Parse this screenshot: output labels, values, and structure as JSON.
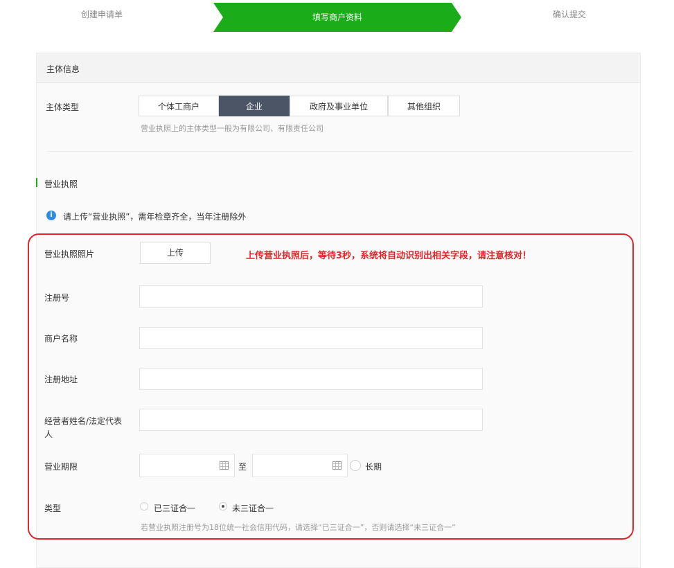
{
  "steps": [
    "创建申请单",
    "填写商户资料",
    "确认提交"
  ],
  "colors": {
    "accent_green": "#1aad19",
    "active_segment": "#4c5566",
    "alert_red": "#e0262b",
    "info_blue": "#2f8be6"
  },
  "panel": {
    "title": "主体信息"
  },
  "entity": {
    "label": "主体类型",
    "options": [
      "个体工商户",
      "企业",
      "政府及事业单位",
      "其他组织"
    ],
    "selected": "企业",
    "hint": "营业执照上的主体类型一般为有限公司、有限责任公司"
  },
  "license": {
    "section_title": "营业执照",
    "info_icon": "info-icon",
    "notice": "请上传“营业执照”，需年检章齐全，当年注册除外",
    "photo_label": "营业执照照片",
    "upload_label": "上传",
    "red_note": "上传营业执照后，等待3秒，系统将自动识别出相关字段，请注意核对！",
    "fields": [
      {
        "label": "注册号",
        "value": ""
      },
      {
        "label": "商户名称",
        "value": ""
      },
      {
        "label": "注册地址",
        "value": ""
      },
      {
        "label": "经营者姓名/法定代表人",
        "value": ""
      }
    ],
    "period": {
      "label": "营业期限",
      "start": "",
      "end": "",
      "to": "至",
      "long_term": "长期",
      "calendar_icon": "calendar-icon"
    },
    "type": {
      "label": "类型",
      "options": [
        "已三证合一",
        "未三证合一"
      ],
      "selected": "未三证合一",
      "hint": "若营业执照注册号为18位统一社会信用代码，请选择“已三证合一”，否则请选择“未三证合一”"
    }
  }
}
